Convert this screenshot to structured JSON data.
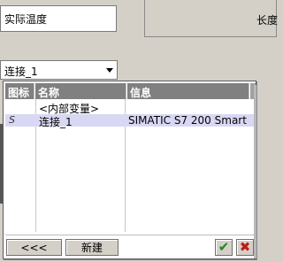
{
  "name_field": {
    "value": "实际温度"
  },
  "right_panel": {
    "label": "长度"
  },
  "connection_combo": {
    "value": "连接_1"
  },
  "dropdown": {
    "columns": {
      "icon": "图标",
      "name": "名称",
      "info": "信息"
    },
    "rows": [
      {
        "icon": "",
        "name": "<内部变量>",
        "info": "",
        "selected": false
      },
      {
        "icon": "S",
        "name": "连接_1",
        "info": "SIMATIC S7 200 Smart",
        "selected": true
      }
    ],
    "buttons": {
      "prev": "<<<",
      "new": "新建"
    }
  },
  "colors": {
    "selected_row": "#d8d8f4",
    "ok": "#1a8a1a",
    "cancel": "#c21a1a"
  },
  "icons": {
    "ok": "check-icon",
    "cancel": "x-icon",
    "dropdown": "chevron-down-icon",
    "row": "s7-connection-icon"
  }
}
